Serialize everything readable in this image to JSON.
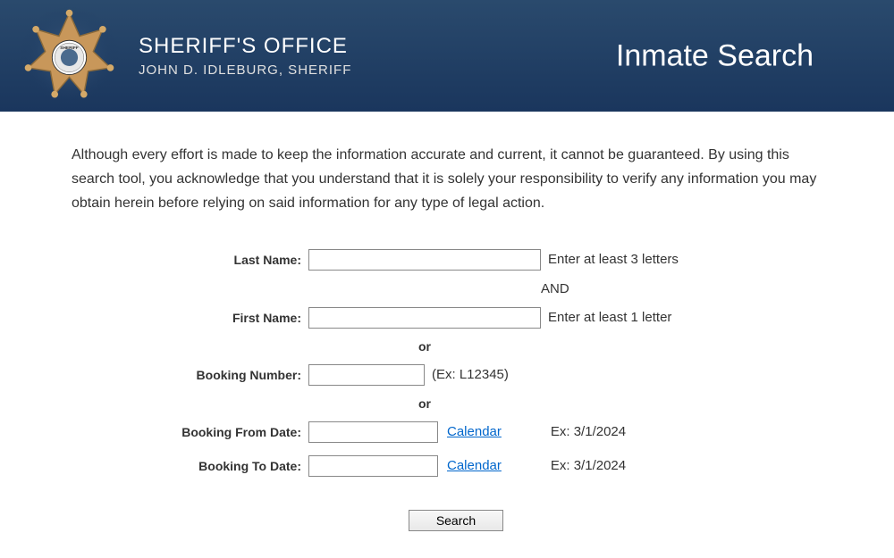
{
  "header": {
    "office_title": "SHERIFF'S OFFICE",
    "sheriff_name": "JOHN D. IDLEBURG, SHERIFF",
    "page_title": "Inmate Search"
  },
  "disclaimer": "Although every effort is made to keep the information accurate and current, it cannot be guaranteed.  By using this search tool, you acknowledge that you understand that it is solely your responsibility to verify any information you may obtain herein before relying on said information for any type of legal action.",
  "form": {
    "last_name": {
      "label": "Last Name:",
      "value": "",
      "hint": "Enter at least 3 letters"
    },
    "and_text": "AND",
    "first_name": {
      "label": "First Name:",
      "value": "",
      "hint": "Enter at least 1 letter"
    },
    "or_text": "or",
    "booking_number": {
      "label": "Booking Number:",
      "value": "",
      "hint": "(Ex: L12345)"
    },
    "booking_from": {
      "label": "Booking From Date:",
      "value": "",
      "calendar_link": "Calendar",
      "example": "Ex: 3/1/2024"
    },
    "booking_to": {
      "label": "Booking To Date:",
      "value": "",
      "calendar_link": "Calendar",
      "example": "Ex: 3/1/2024"
    },
    "search_button": "Search"
  },
  "colors": {
    "header_bg": "#1a365d",
    "link_color": "#0066cc"
  }
}
